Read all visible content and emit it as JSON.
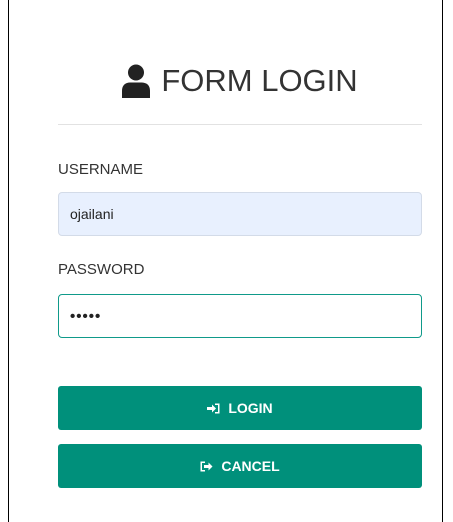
{
  "form": {
    "title": "FORM LOGIN",
    "title_icon": "user-icon",
    "username_label": "USERNAME",
    "username_value": "ojailani",
    "password_label": "PASSWORD",
    "password_value": "•••••",
    "login_label": "LOGIN",
    "login_icon": "sign-in-icon",
    "cancel_label": "CANCEL",
    "cancel_icon": "sign-out-icon"
  },
  "colors": {
    "accent": "#00907b",
    "input_focus_border": "#0f9a8a",
    "autofill_background": "#e8f0fe",
    "text": "#333333"
  }
}
